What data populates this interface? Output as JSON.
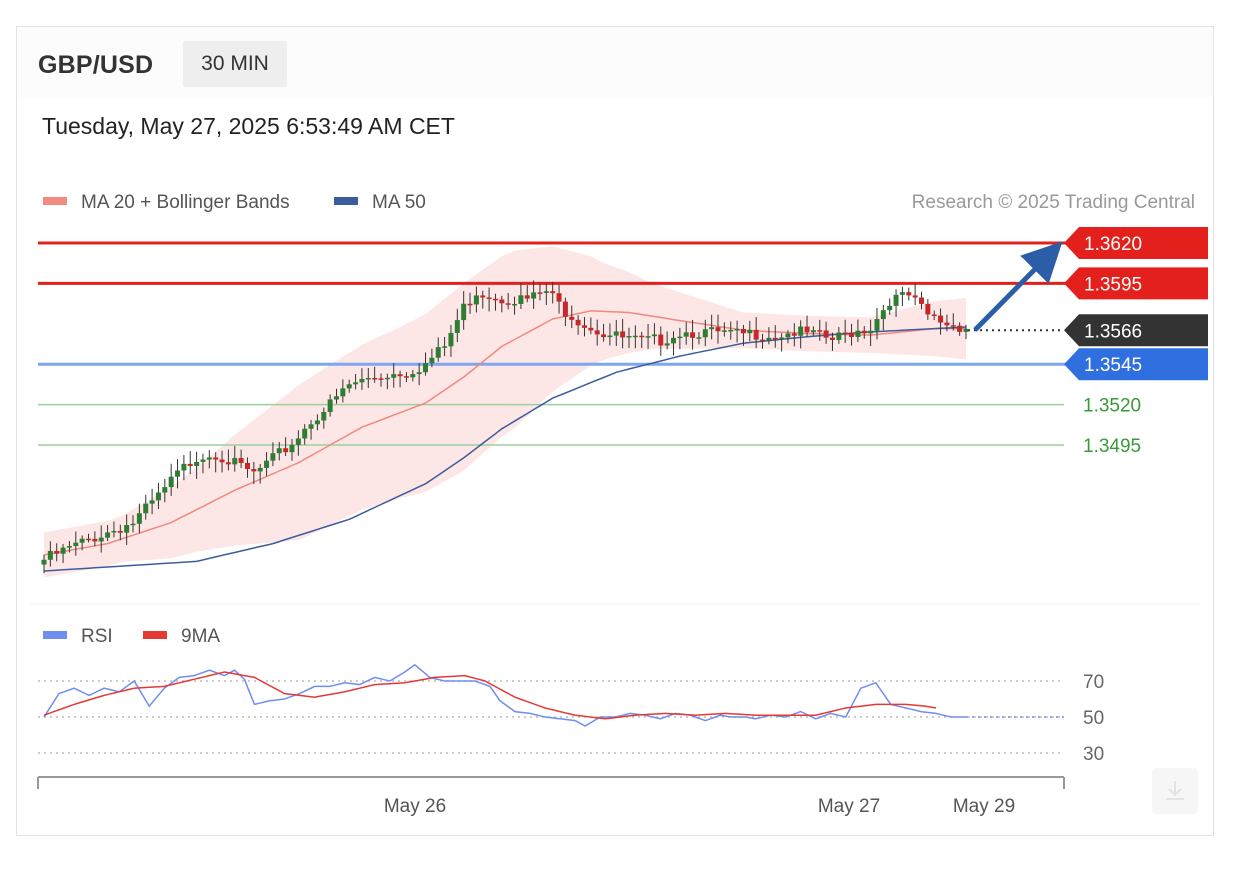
{
  "header": {
    "symbol": "GBP/USD",
    "timeframe": "30 MIN",
    "datetime": "Tuesday, May 27, 2025 6:53:49 AM CET"
  },
  "legend": {
    "ma20": "MA 20 + Bollinger Bands",
    "ma50": "MA 50",
    "copyright": "Research © 2025 Trading Central",
    "rsi": "RSI",
    "ma9": "9MA"
  },
  "colors": {
    "resistance": "#e3201b",
    "pivot": "#2f6fe0",
    "support": "#3a9a3a",
    "current": "#333333",
    "ma20": "#f08a80",
    "ma50": "#3c5d9c",
    "band": "#fde2e2",
    "up_candle": "#2e7d32",
    "down_candle": "#c62828",
    "rsi": "#6f8ef0",
    "ma9": "#e53935",
    "arrow": "#2c5ea8"
  },
  "chart_data": {
    "type": "candlestick",
    "instrument": "GBP/USD",
    "interval": "30 MIN",
    "x_ticks": [
      "May 26",
      "May 27",
      "May 29"
    ],
    "ylim": [
      1.341,
      1.363
    ],
    "levels": [
      {
        "value": 1.362,
        "label": "1.3620",
        "kind": "resistance"
      },
      {
        "value": 1.3595,
        "label": "1.3595",
        "kind": "resistance"
      },
      {
        "value": 1.3566,
        "label": "1.3566",
        "kind": "current"
      },
      {
        "value": 1.3545,
        "label": "1.3545",
        "kind": "pivot"
      },
      {
        "value": 1.352,
        "label": "1.3520",
        "kind": "support"
      },
      {
        "value": 1.3495,
        "label": "1.3495",
        "kind": "support"
      }
    ],
    "anchors": [
      [
        0,
        1.3424
      ],
      [
        8,
        1.3438
      ],
      [
        14,
        1.3447
      ],
      [
        18,
        1.3463
      ],
      [
        21,
        1.3477
      ],
      [
        24,
        1.3488
      ],
      [
        27,
        1.349
      ],
      [
        30,
        1.3483
      ],
      [
        33,
        1.3477
      ],
      [
        36,
        1.3486
      ],
      [
        39,
        1.3496
      ],
      [
        42,
        1.351
      ],
      [
        45,
        1.352
      ],
      [
        48,
        1.3532
      ],
      [
        51,
        1.3536
      ],
      [
        54,
        1.3539
      ],
      [
        57,
        1.354
      ],
      [
        60,
        1.3545
      ],
      [
        63,
        1.3556
      ],
      [
        66,
        1.358
      ],
      [
        68,
        1.359
      ],
      [
        72,
        1.3586
      ],
      [
        76,
        1.3585
      ],
      [
        79,
        1.359
      ],
      [
        82,
        1.3578
      ],
      [
        85,
        1.357
      ],
      [
        88,
        1.3564
      ],
      [
        91,
        1.3561
      ],
      [
        94,
        1.3559
      ],
      [
        97,
        1.356
      ],
      [
        100,
        1.3565
      ],
      [
        103,
        1.3565
      ],
      [
        106,
        1.3564
      ],
      [
        109,
        1.3563
      ],
      [
        112,
        1.3564
      ],
      [
        115,
        1.3563
      ],
      [
        118,
        1.3565
      ],
      [
        121,
        1.3563
      ],
      [
        124,
        1.356
      ],
      [
        127,
        1.3565
      ],
      [
        130,
        1.3568
      ],
      [
        133,
        1.3585
      ],
      [
        136,
        1.3587
      ],
      [
        139,
        1.3575
      ],
      [
        142,
        1.357
      ],
      [
        145,
        1.3568
      ]
    ],
    "ma20_anchors": [
      [
        0,
        1.3427
      ],
      [
        10,
        1.3434
      ],
      [
        20,
        1.3447
      ],
      [
        30,
        1.3467
      ],
      [
        40,
        1.3484
      ],
      [
        50,
        1.3506
      ],
      [
        60,
        1.3521
      ],
      [
        66,
        1.3537
      ],
      [
        72,
        1.3556
      ],
      [
        80,
        1.3573
      ],
      [
        86,
        1.3578
      ],
      [
        92,
        1.3577
      ],
      [
        100,
        1.3572
      ],
      [
        110,
        1.3566
      ],
      [
        120,
        1.3564
      ],
      [
        130,
        1.3563
      ],
      [
        140,
        1.3567
      ],
      [
        145,
        1.3567
      ]
    ],
    "ma50_anchors": [
      [
        0,
        1.3417
      ],
      [
        12,
        1.342
      ],
      [
        24,
        1.3423
      ],
      [
        36,
        1.3434
      ],
      [
        48,
        1.3449
      ],
      [
        60,
        1.3471
      ],
      [
        66,
        1.3487
      ],
      [
        72,
        1.3505
      ],
      [
        80,
        1.3524
      ],
      [
        90,
        1.354
      ],
      [
        100,
        1.355
      ],
      [
        110,
        1.3558
      ],
      [
        120,
        1.3562
      ],
      [
        130,
        1.3565
      ],
      [
        140,
        1.3567
      ],
      [
        145,
        1.3568
      ]
    ],
    "band_width_anchors": [
      [
        0,
        0.0014
      ],
      [
        12,
        0.0014
      ],
      [
        24,
        0.0026
      ],
      [
        40,
        0.0048
      ],
      [
        56,
        0.0053
      ],
      [
        66,
        0.0058
      ],
      [
        74,
        0.0055
      ],
      [
        80,
        0.0045
      ],
      [
        88,
        0.003
      ],
      [
        96,
        0.002
      ],
      [
        110,
        0.0011
      ],
      [
        130,
        0.0011
      ],
      [
        140,
        0.0017
      ],
      [
        145,
        0.0019
      ]
    ],
    "rsi": {
      "ylim": [
        20,
        80
      ],
      "levels": [
        70,
        50,
        30
      ],
      "rsi_anchors": [
        [
          0,
          50
        ],
        [
          3,
          63
        ],
        [
          6,
          66
        ],
        [
          9,
          62
        ],
        [
          12,
          66
        ],
        [
          15,
          64
        ],
        [
          18,
          70
        ],
        [
          21,
          56
        ],
        [
          24,
          66
        ],
        [
          27,
          72
        ],
        [
          30,
          73
        ],
        [
          33,
          76
        ],
        [
          36,
          73
        ],
        [
          38,
          76
        ],
        [
          40,
          71
        ],
        [
          42,
          57
        ],
        [
          45,
          59
        ],
        [
          48,
          60
        ],
        [
          51,
          63
        ],
        [
          54,
          67
        ],
        [
          57,
          67
        ],
        [
          60,
          69
        ],
        [
          63,
          68
        ],
        [
          66,
          72
        ],
        [
          69,
          70
        ],
        [
          72,
          75
        ],
        [
          74,
          79
        ],
        [
          77,
          72
        ],
        [
          80,
          70
        ],
        [
          83,
          70
        ],
        [
          86,
          70
        ],
        [
          89,
          67
        ],
        [
          91,
          59
        ],
        [
          94,
          53
        ],
        [
          97,
          52
        ],
        [
          100,
          50
        ],
        [
          103,
          49
        ],
        [
          106,
          48
        ],
        [
          108,
          45
        ],
        [
          111,
          50
        ],
        [
          114,
          50
        ],
        [
          117,
          52
        ],
        [
          120,
          51
        ],
        [
          123,
          49
        ],
        [
          126,
          52
        ],
        [
          129,
          51
        ],
        [
          132,
          48
        ],
        [
          135,
          51
        ],
        [
          137,
          50
        ],
        [
          140,
          50
        ],
        [
          142,
          49
        ],
        [
          145,
          51
        ],
        [
          148,
          50
        ],
        [
          151,
          53
        ],
        [
          154,
          49
        ],
        [
          157,
          52
        ],
        [
          160,
          50
        ],
        [
          163,
          66
        ],
        [
          166,
          69
        ],
        [
          169,
          57
        ],
        [
          172,
          55
        ],
        [
          175,
          53
        ],
        [
          178,
          52
        ],
        [
          181,
          50
        ],
        [
          184,
          50
        ]
      ],
      "ma9_anchors": [
        [
          0,
          51
        ],
        [
          6,
          57
        ],
        [
          12,
          62
        ],
        [
          18,
          66
        ],
        [
          24,
          67
        ],
        [
          30,
          71
        ],
        [
          36,
          75
        ],
        [
          42,
          72
        ],
        [
          48,
          63
        ],
        [
          54,
          61
        ],
        [
          60,
          64
        ],
        [
          66,
          68
        ],
        [
          72,
          69
        ],
        [
          78,
          72
        ],
        [
          84,
          73
        ],
        [
          88,
          70
        ],
        [
          94,
          61
        ],
        [
          100,
          55
        ],
        [
          106,
          51
        ],
        [
          112,
          49
        ],
        [
          118,
          51
        ],
        [
          124,
          52
        ],
        [
          130,
          51
        ],
        [
          136,
          52
        ],
        [
          142,
          51
        ],
        [
          148,
          51
        ],
        [
          154,
          51
        ],
        [
          160,
          55
        ],
        [
          166,
          57
        ],
        [
          172,
          57
        ],
        [
          176,
          56
        ],
        [
          178,
          55
        ]
      ]
    }
  }
}
